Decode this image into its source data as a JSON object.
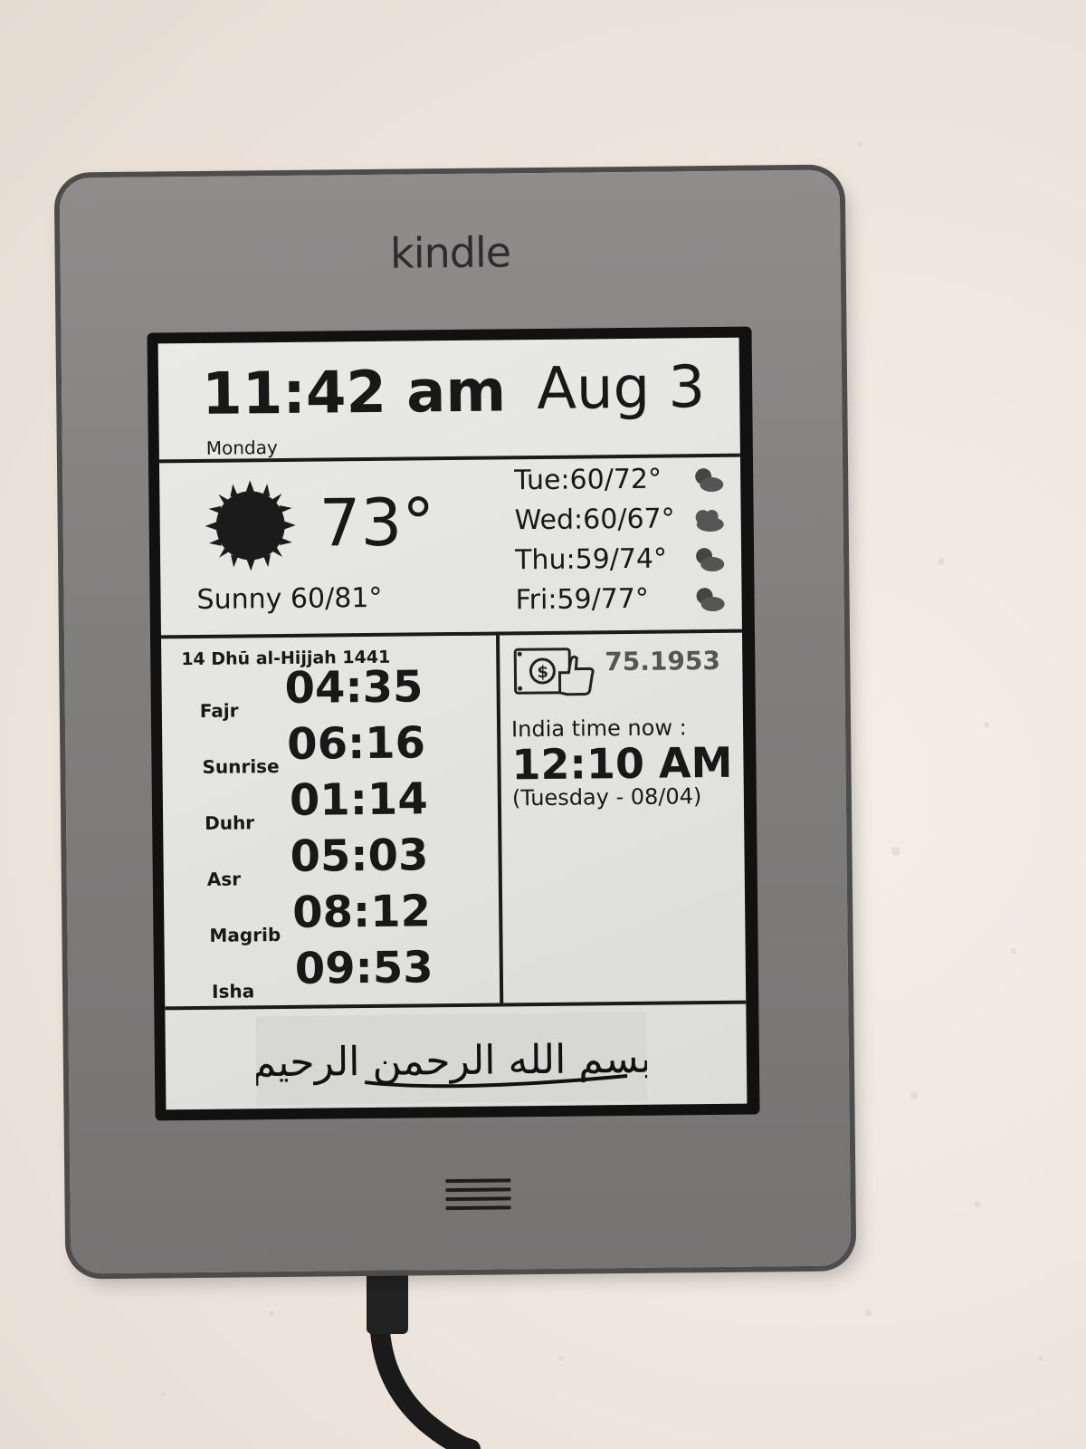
{
  "device": {
    "brand_label": "kindle"
  },
  "clock": {
    "time": "11:42 am",
    "date": "Aug 3",
    "weekday": "Monday"
  },
  "weather": {
    "current_temp": "73°",
    "condition": "Sunny 60/81°",
    "forecast": [
      {
        "text": "Tue:60/72°",
        "icon": "partly-cloudy-icon"
      },
      {
        "text": "Wed:60/67°",
        "icon": "cloudy-icon"
      },
      {
        "text": "Thu:59/74°",
        "icon": "partly-cloudy-icon"
      },
      {
        "text": "Fri:59/77°",
        "icon": "partly-cloudy-icon"
      }
    ]
  },
  "prayer": {
    "hijri_date": "14 Dhū al-Hijjah 1441",
    "times": [
      {
        "name": "Fajr",
        "time": "04:35"
      },
      {
        "name": "Sunrise",
        "time": "06:16"
      },
      {
        "name": "Duhr",
        "time": "01:14"
      },
      {
        "name": "Asr",
        "time": "05:03"
      },
      {
        "name": "Magrib",
        "time": "08:12"
      },
      {
        "name": "Isha",
        "time": "09:53"
      }
    ]
  },
  "currency": {
    "rate": "75.1953",
    "icon": "money-thumbs-up-icon"
  },
  "india": {
    "label": "India time now :",
    "time": "12:10 AM",
    "date": "(Tuesday - 08/04)"
  },
  "banner": {
    "calligraphy": "بسم الله الرحمن الرحيم"
  }
}
